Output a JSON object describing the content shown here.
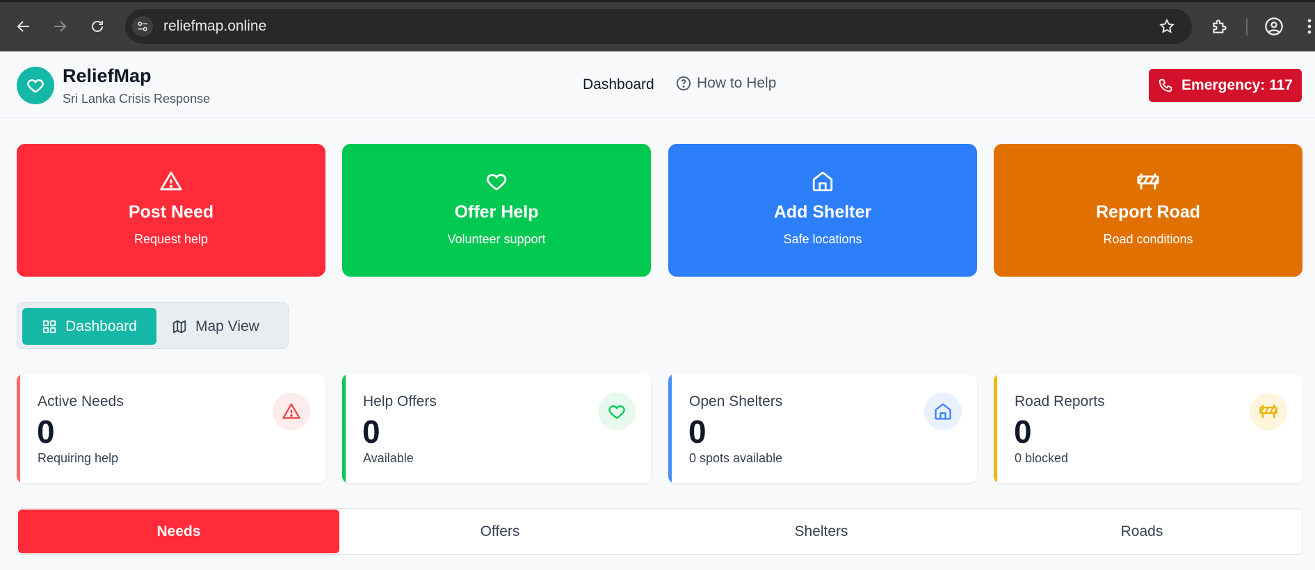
{
  "browser": {
    "url": "reliefmap.online"
  },
  "header": {
    "brand_title": "ReliefMap",
    "brand_subtitle": "Sri Lanka Crisis Response",
    "nav_dashboard": "Dashboard",
    "nav_how_to_help": "How to Help",
    "emergency_label": "Emergency: 117"
  },
  "actions": [
    {
      "title": "Post Need",
      "subtitle": "Request help",
      "color": "#ff2b38",
      "icon": "alert-triangle-icon"
    },
    {
      "title": "Offer Help",
      "subtitle": "Volunteer support",
      "color": "#00c851",
      "icon": "heart-icon"
    },
    {
      "title": "Add Shelter",
      "subtitle": "Safe locations",
      "color": "#2d7ff9",
      "icon": "home-icon"
    },
    {
      "title": "Report Road",
      "subtitle": "Road conditions",
      "color": "#e07000",
      "icon": "road-barrier-icon"
    }
  ],
  "view_toggle": {
    "dashboard_label": "Dashboard",
    "map_label": "Map View",
    "active": "Dashboard"
  },
  "stats": [
    {
      "label": "Active Needs",
      "value": "0",
      "note": "Requiring help",
      "accent": "#f26b6b",
      "icon": "alert-triangle-icon"
    },
    {
      "label": "Help Offers",
      "value": "0",
      "note": "Available",
      "accent": "#00c851",
      "icon": "heart-icon"
    },
    {
      "label": "Open Shelters",
      "value": "0",
      "note": "0 spots available",
      "accent": "#4a90f5",
      "icon": "home-icon"
    },
    {
      "label": "Road Reports",
      "value": "0",
      "note": "0 blocked",
      "accent": "#f2b705",
      "icon": "road-barrier-icon"
    }
  ],
  "tabs": {
    "items": [
      "Needs",
      "Offers",
      "Shelters",
      "Roads"
    ],
    "active": "Needs"
  }
}
